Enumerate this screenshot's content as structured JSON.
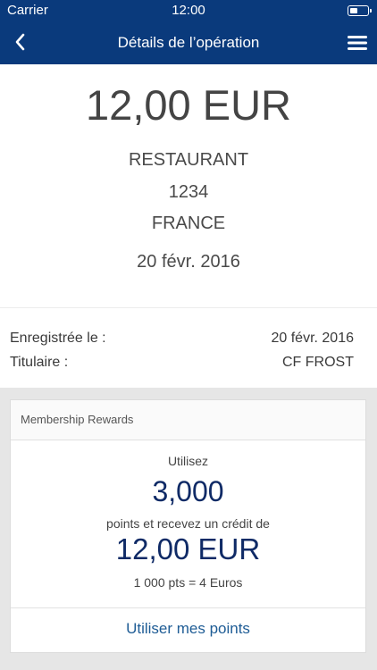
{
  "status_bar": {
    "carrier": "Carrier",
    "time": "12:00"
  },
  "nav": {
    "title": "Détails de l’opération",
    "back_icon": "chevron-left-icon",
    "menu_icon": "hamburger-menu-icon"
  },
  "transaction": {
    "amount": "12,00 EUR",
    "merchant": "RESTAURANT",
    "code": "1234",
    "country": "FRANCE",
    "date": "20 févr. 2016"
  },
  "details": {
    "registered_label": "Enregistrée le :",
    "registered_value": "20 févr. 2016",
    "holder_label": "Titulaire :",
    "holder_value": "CF FROST"
  },
  "rewards": {
    "header": "Membership Rewards",
    "use_label": "Utilisez",
    "points": "3,000",
    "receive_text": "points et recevez un crédit de",
    "credit": "12,00 EUR",
    "rate": "1 000 pts = 4 Euros",
    "action": "Utiliser mes points"
  },
  "colors": {
    "nav_bg": "#0a3a7c",
    "accent_text": "#0f2a66",
    "link": "#1e5c95"
  }
}
